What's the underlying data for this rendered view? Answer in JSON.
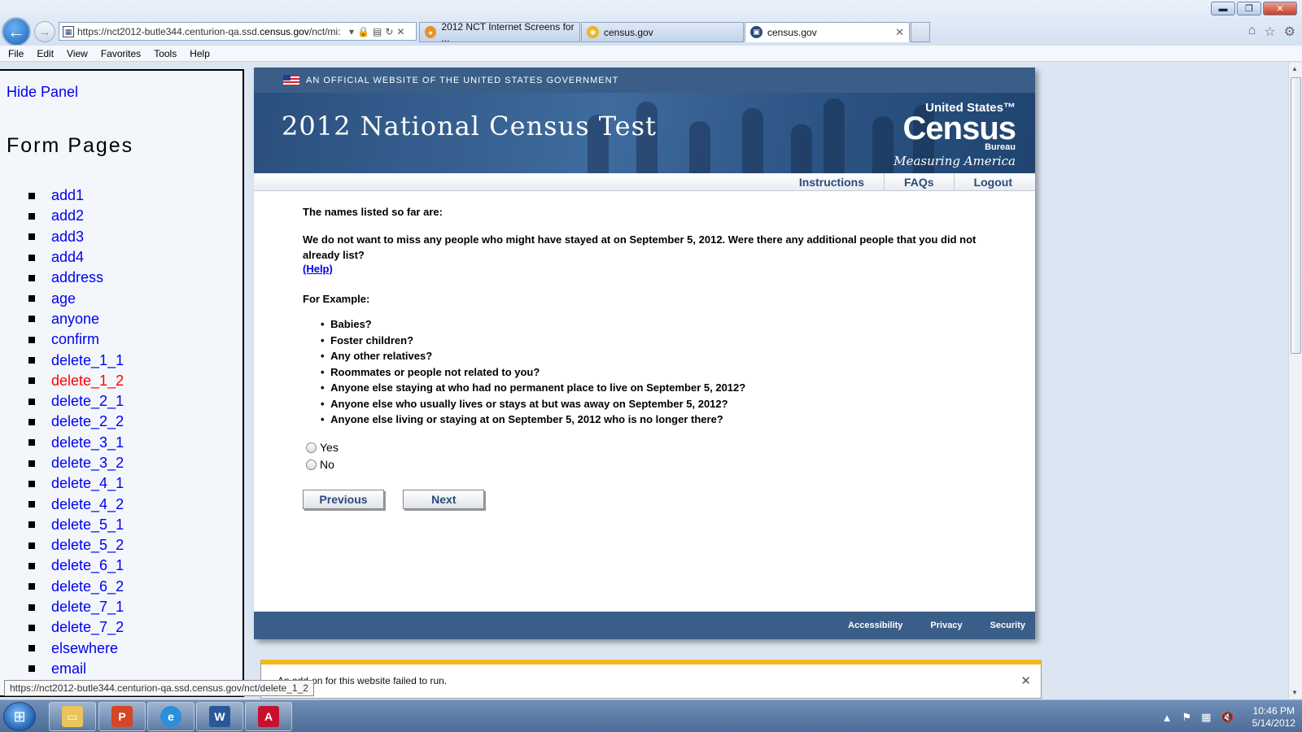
{
  "browser": {
    "url_prefix": "https://nct2012-butle344.centurion-qa.ssd.",
    "url_domain": "census.gov",
    "url_suffix": "/nct/mi:",
    "tabs": [
      {
        "label": "2012 NCT Internet Screens for ..."
      },
      {
        "label": "census.gov"
      },
      {
        "label": "census.gov"
      }
    ],
    "menu": [
      "File",
      "Edit",
      "View",
      "Favorites",
      "Tools",
      "Help"
    ],
    "status_url": "https://nct2012-butle344.centurion-qa.ssd.census.gov/nct/delete_1_2"
  },
  "side_panel": {
    "hide_label": "Hide Panel",
    "title": "Form Pages",
    "pages": [
      "add1",
      "add2",
      "add3",
      "add4",
      "address",
      "age",
      "anyone",
      "confirm",
      "delete_1_1",
      "delete_1_2",
      "delete_2_1",
      "delete_2_2",
      "delete_3_1",
      "delete_3_2",
      "delete_4_1",
      "delete_4_2",
      "delete_5_1",
      "delete_5_2",
      "delete_6_1",
      "delete_6_2",
      "delete_7_1",
      "delete_7_2",
      "elsewhere",
      "email"
    ],
    "current_page": "delete_1_2"
  },
  "census": {
    "gov_banner": "AN OFFICIAL WEBSITE OF THE UNITED STATES GOVERNMENT",
    "title": "2012 National Census Test",
    "logo_us": "United States™",
    "logo_census": "Census",
    "logo_bureau": "Bureau",
    "logo_tagline": "Measuring America",
    "nav": [
      "Instructions",
      "FAQs",
      "Logout"
    ],
    "names_listed": "The names listed so far are:",
    "question": "We do not want to miss any people who might have stayed at on September 5, 2012. Were there any additional people that you did not already list?",
    "help_link": "(Help)",
    "for_example": "For Example:",
    "examples": [
      "Babies?",
      "Foster children?",
      "Any other relatives?",
      "Roommates or people not related to you?",
      "Anyone else staying at who had no permanent place to live on September 5, 2012?",
      "Anyone else who usually lives or stays at but was away on September 5, 2012?",
      "Anyone else living or staying at on September 5, 2012 who is no longer there?"
    ],
    "options": [
      "Yes",
      "No"
    ],
    "previous_label": "Previous",
    "next_label": "Next",
    "footer": [
      "Accessibility",
      "Privacy",
      "Security"
    ]
  },
  "notification": {
    "message": "An add-on for this website failed to run."
  },
  "taskbar": {
    "time": "10:46 PM",
    "date": "5/14/2012"
  },
  "colors": {
    "link": "#0000ee",
    "current_page": "#ff0000",
    "census_blue": "#3a5e88",
    "notify_accent": "#f2b81a"
  }
}
